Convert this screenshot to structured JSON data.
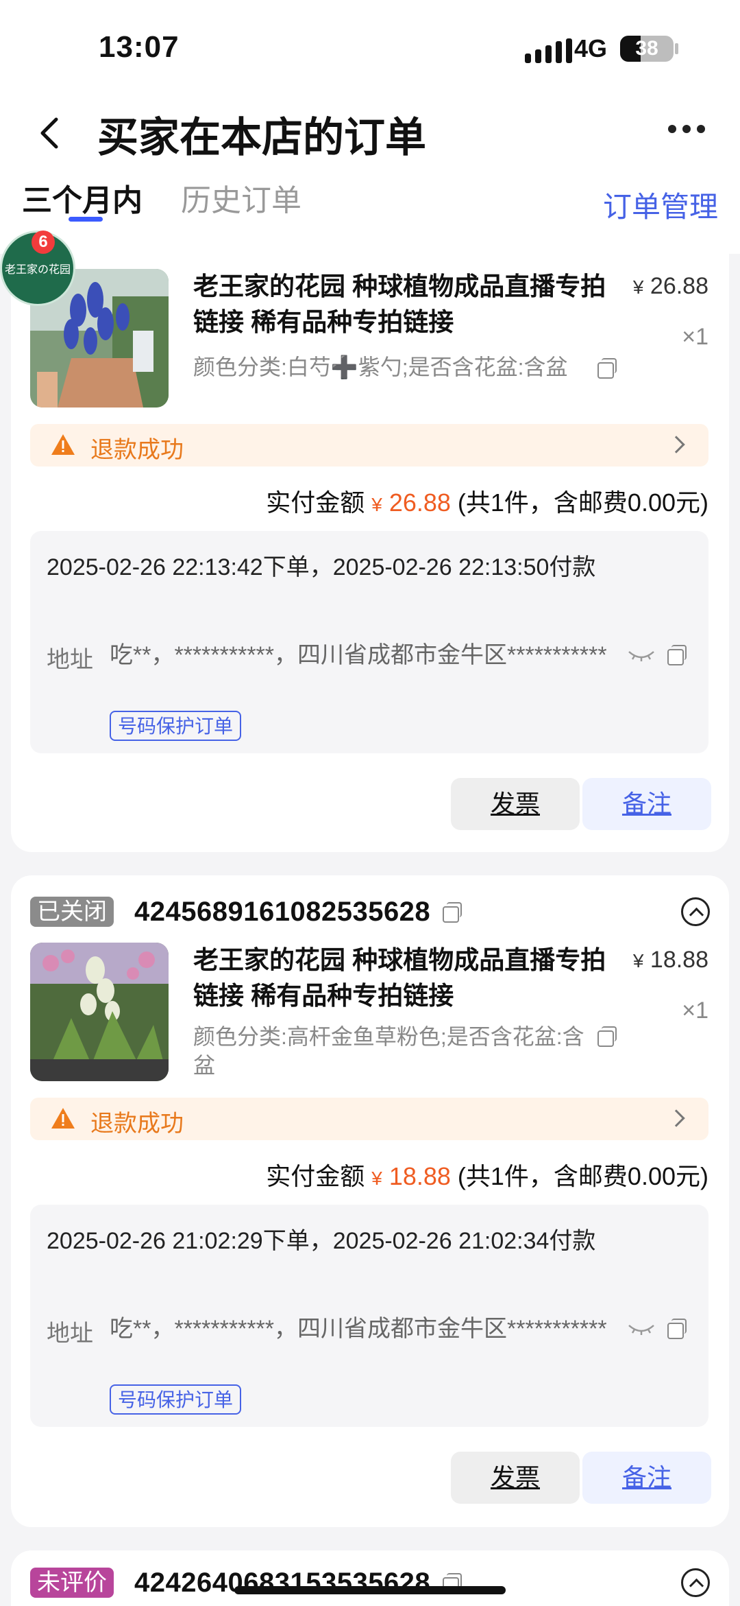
{
  "status_bar": {
    "time": "13:07",
    "network": "4G",
    "battery": "38",
    "battery_level": 38
  },
  "nav": {
    "title": "买家在本店的订单"
  },
  "tabs": {
    "active": "三个月内",
    "history": "历史订单",
    "manage": "订单管理"
  },
  "shop_badge": {
    "name": "老王家の花园",
    "count": "6"
  },
  "orders": [
    {
      "product_title": "老王家的花园 种球植物成品直播专拍链接 稀有品种专拍链接",
      "spec": "颜色分类:白芍➕紫勺;是否含花盆:含盆",
      "price_symbol": "¥",
      "price": "26.88",
      "qty": "×1",
      "refund_status": "退款成功",
      "paid_label": "实付金额",
      "paid_amount": "26.88",
      "paid_note": "(共1件，含邮费0.00元)",
      "time_text": "2025-02-26 22:13:42下单，2025-02-26 22:13:50付款",
      "addr_label": "地址",
      "addr_text": "吃**，***********，四川省成都市金牛区***********",
      "protect_tag": "号码保护订单",
      "btn_invoice": "发票",
      "btn_note": "备注"
    },
    {
      "status_badge": "已关闭",
      "order_no": "4245689161082535628",
      "product_title": "老王家的花园 种球植物成品直播专拍链接 稀有品种专拍链接",
      "spec": "颜色分类:高杆金鱼草粉色;是否含花盆:含盆",
      "price_symbol": "¥",
      "price": "18.88",
      "qty": "×1",
      "refund_status": "退款成功",
      "paid_label": "实付金额",
      "paid_amount": "18.88",
      "paid_note": "(共1件，含邮费0.00元)",
      "time_text": "2025-02-26 21:02:29下单，2025-02-26 21:02:34付款",
      "addr_label": "地址",
      "addr_text": "吃**，***********，四川省成都市金牛区***********",
      "protect_tag": "号码保护订单",
      "btn_invoice": "发票",
      "btn_note": "备注"
    },
    {
      "status_badge": "未评价",
      "order_no": "4242640683153535628"
    }
  ]
}
